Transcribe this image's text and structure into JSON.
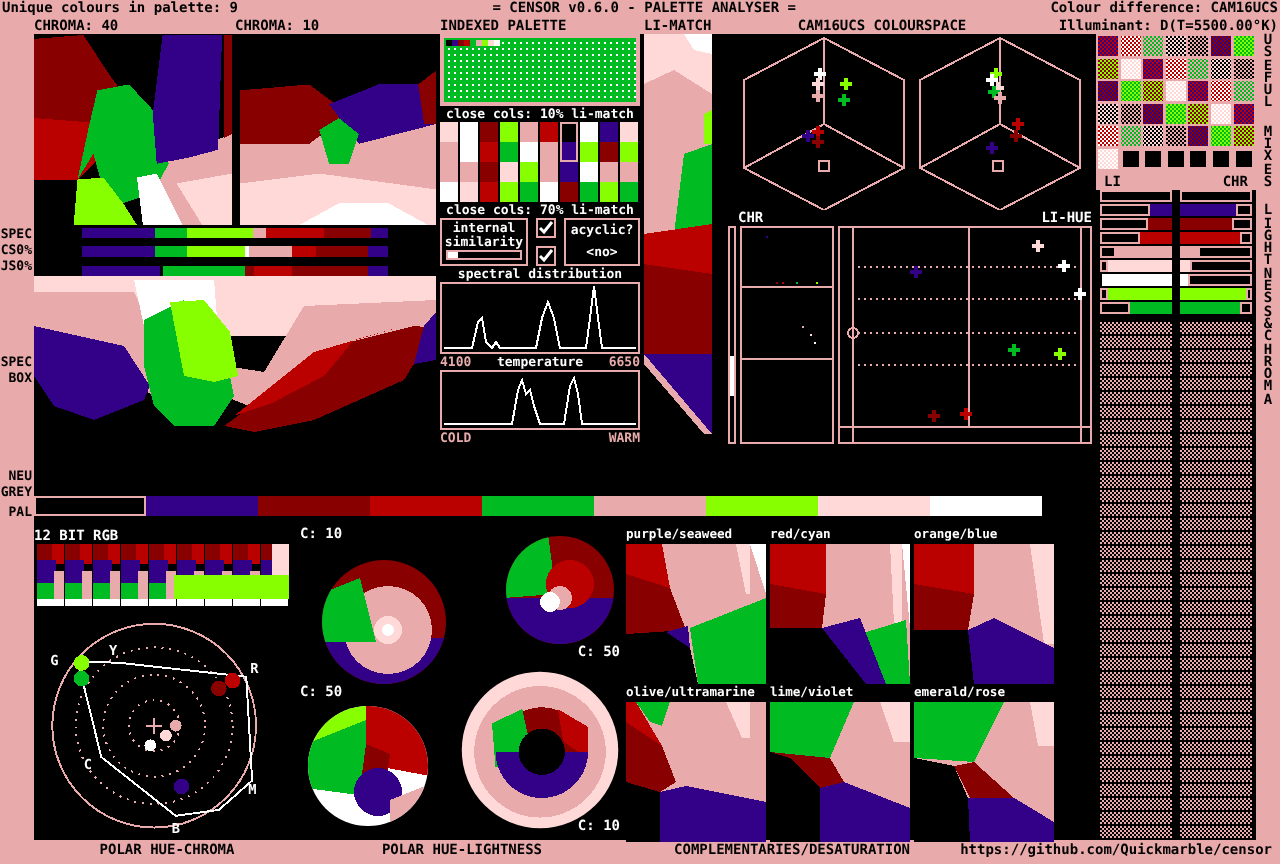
{
  "header": {
    "palette_count": "Unique colours in palette: 9",
    "title": "= CENSOR v0.6.0 - PALETTE ANALYSER =",
    "colour_difference": "Colour difference: CAM16UCS",
    "illuminant": "Illuminant: D(T=5500.00°K)"
  },
  "palette": [
    {
      "color": "#000000"
    },
    {
      "color": "#330088"
    },
    {
      "color": "#880000"
    },
    {
      "color": "#bb0000"
    },
    {
      "color": "#00bb22"
    },
    {
      "color": "#e8aaaa"
    },
    {
      "color": "#88ff00"
    },
    {
      "color": "#ffd8d8"
    },
    {
      "color": "#ffffff"
    }
  ],
  "chroma_views": [
    {
      "label": "CHROMA: 40"
    },
    {
      "label": "CHROMA: 10"
    }
  ],
  "row_labels": {
    "spec": "SPEC",
    "cs": "CS0%",
    "js": "JS0%",
    "spec_box": "SPEC BOX",
    "neu_grey": "NEU GREY",
    "pal": "PAL"
  },
  "indexed_palette": {
    "title": "INDEXED PALETTE",
    "close_cols": [
      "close cols: 10% li-match",
      "close cols: 70% li-match"
    ],
    "internal_similarity": {
      "label": "internal similarity",
      "checked": true,
      "level": 0.15
    },
    "acyclic": {
      "label": "acyclic?",
      "checked": true,
      "value": "<no>"
    },
    "spectral": {
      "title": "spectral distribution",
      "min": "4100",
      "axis": "temperature",
      "max": "6650"
    },
    "temperature": {
      "left": "COLD",
      "right": "WARM"
    }
  },
  "li_match": {
    "title": "LI-MATCH"
  },
  "colourspace": {
    "title": "CAM16UCS COLOURSPACE",
    "chr_label": "CHR",
    "li_hue_label": "LI-HUE"
  },
  "side": {
    "li_label": "LI",
    "chr_label": "CHR",
    "vertical": [
      "USEFUL",
      "MIXES",
      "LIGHTNESS & CHROMA"
    ]
  },
  "polar": {
    "rgb_label": "12 BIT RGB",
    "hue_letters": [
      "G",
      "Y",
      "R",
      "C",
      "M",
      "B"
    ],
    "lightness_labels": [
      "C: 10",
      "C: 50",
      "C: 50",
      "C: 10"
    ]
  },
  "complementaries": [
    {
      "label": "purple/seaweed"
    },
    {
      "label": "red/cyan"
    },
    {
      "label": "orange/blue"
    },
    {
      "label": "olive/ultramarine"
    },
    {
      "label": "lime/violet"
    },
    {
      "label": "emerald/rose"
    }
  ],
  "footer": {
    "polar_hue_chroma": "POLAR HUE-CHROMA",
    "polar_hue_lightness": "POLAR HUE-LIGHTNESS",
    "complementaries": "COMPLEMENTARIES/DESATURATION",
    "url": "https://github.com/Quickmarble/censor"
  }
}
